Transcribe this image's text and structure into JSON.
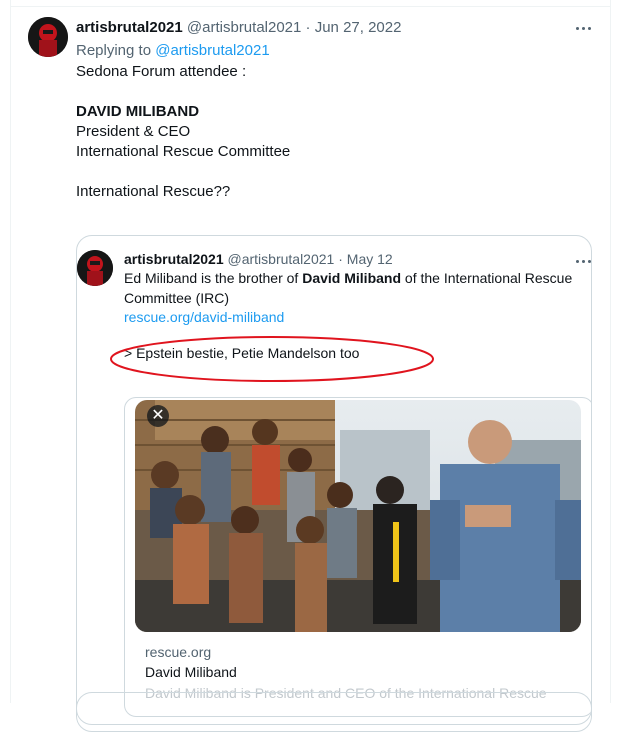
{
  "tweet": {
    "display_name": "artisbrutal2021",
    "handle": "@artisbrutal2021",
    "separator": "·",
    "date": "Jun 27, 2022",
    "replying_prefix": "Replying to",
    "replying_to": "@artisbrutal2021",
    "lines": [
      "Sedona Forum attendee :",
      "DAVID MILIBAND",
      "President & CEO",
      "International Rescue Committee",
      "International Rescue??"
    ]
  },
  "quoted": {
    "display_name": "artisbrutal2021",
    "handle": "@artisbrutal2021",
    "separator": "·",
    "date": "May 12",
    "line1_prefix": "Ed Miliband is the brother of ",
    "line1_bold": "David Miliband",
    "line1_suffix": " of the International Rescue",
    "line2": "Committee (IRC)",
    "link": "rescue.org/david-miliband",
    "line3": "> Epstein bestie, Petie Mandelson too",
    "card": {
      "close_symbol": "✕",
      "domain": "rescue.org",
      "title": "David Miliband",
      "description": "David Miliband is President and CEO of the International Rescue"
    }
  },
  "colors": {
    "accent": "#1d9bf0",
    "secondary_text": "#536471",
    "annotation": "#e0141e"
  },
  "icons": {
    "more": "more-horizontal-icon",
    "close": "close-icon"
  }
}
